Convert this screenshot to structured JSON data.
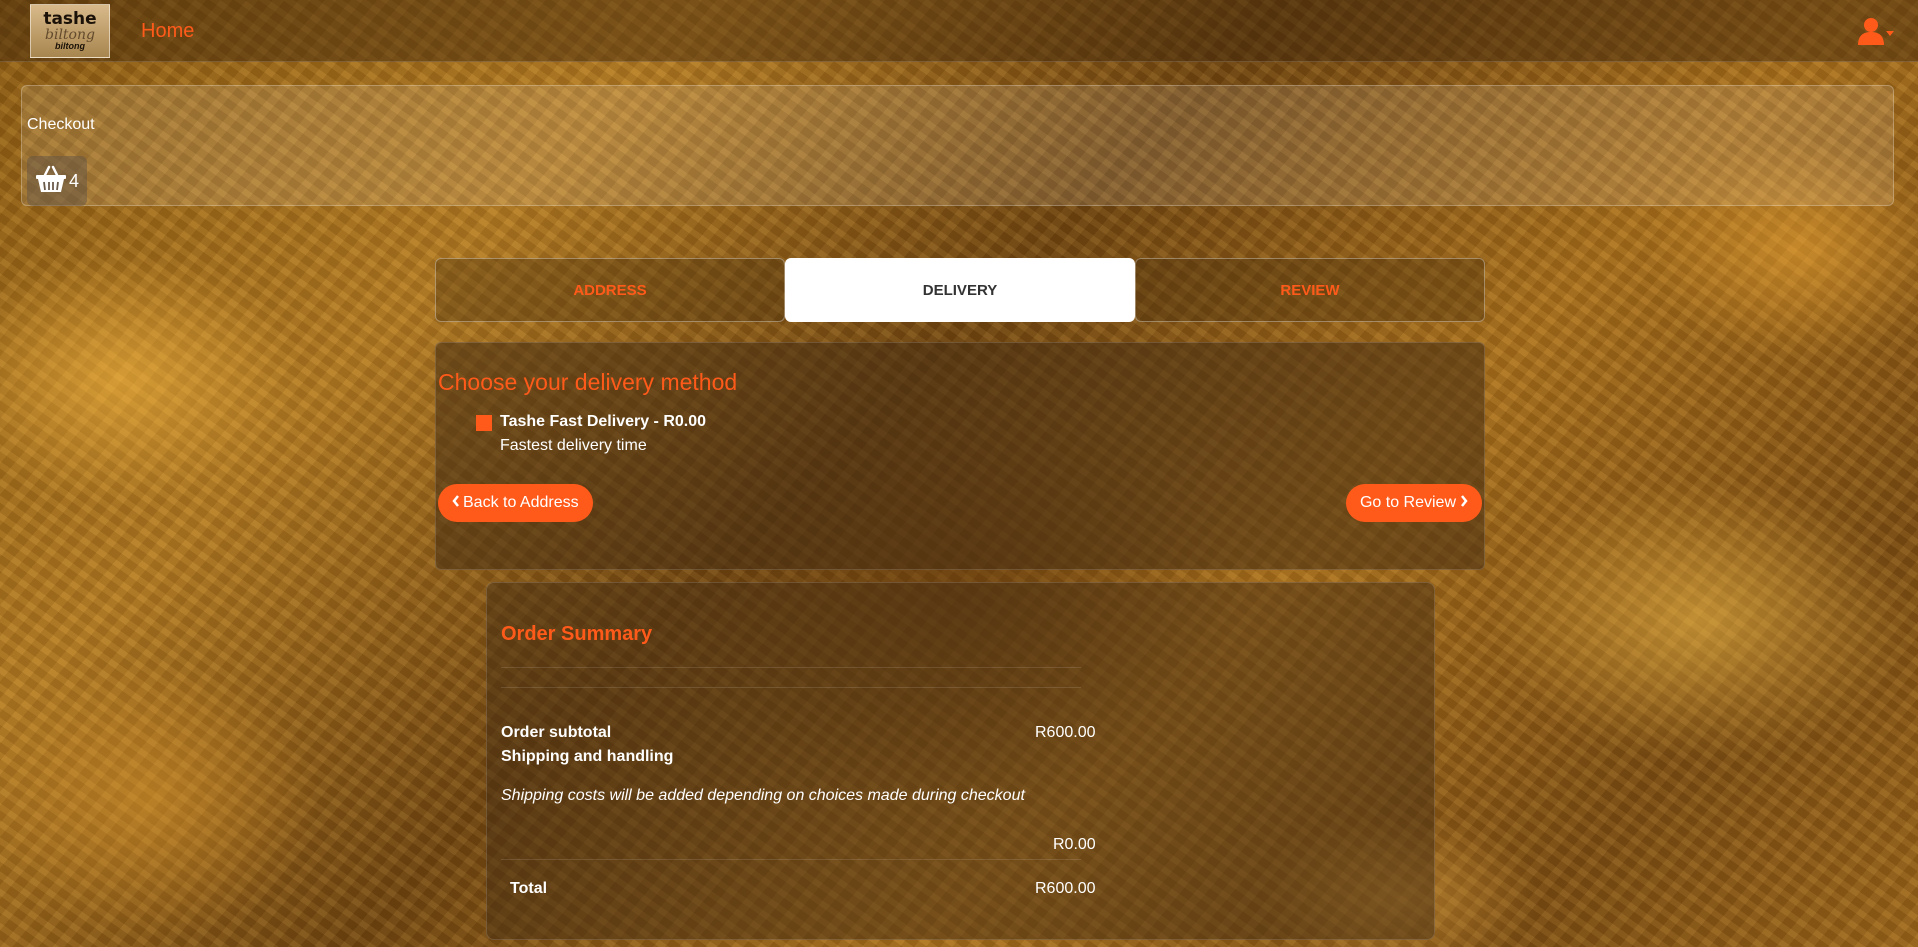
{
  "nav": {
    "logo_line1": "tashe",
    "logo_line2": "biltong",
    "logo_line3": "biltong",
    "home_label": "Home",
    "accent": "#ff5a1a"
  },
  "checkout": {
    "title": "Checkout",
    "cart_count": "4"
  },
  "tabs": [
    {
      "label": "ADDRESS",
      "active": false
    },
    {
      "label": "DELIVERY",
      "active": true
    },
    {
      "label": "REVIEW",
      "active": false
    }
  ],
  "delivery": {
    "heading": "Choose your delivery method",
    "option_name": "Tashe Fast Delivery - R0.00",
    "option_desc": "Fastest delivery time",
    "back_label": "Back to Address",
    "next_label": "Go to Review"
  },
  "summary": {
    "title": "Order Summary",
    "subtotal_label": "Order subtotal",
    "subtotal_value": "R600.00",
    "shipping_label": "Shipping and handling",
    "shipping_note": "Shipping costs will be added depending on choices made during checkout",
    "shipping_value": "R0.00",
    "total_label": "Total",
    "total_value": "R600.00"
  },
  "icons": {
    "user": "user-icon",
    "cart": "basket-icon",
    "chevron_left": "chevron-left-icon",
    "chevron_right": "chevron-right-icon"
  }
}
